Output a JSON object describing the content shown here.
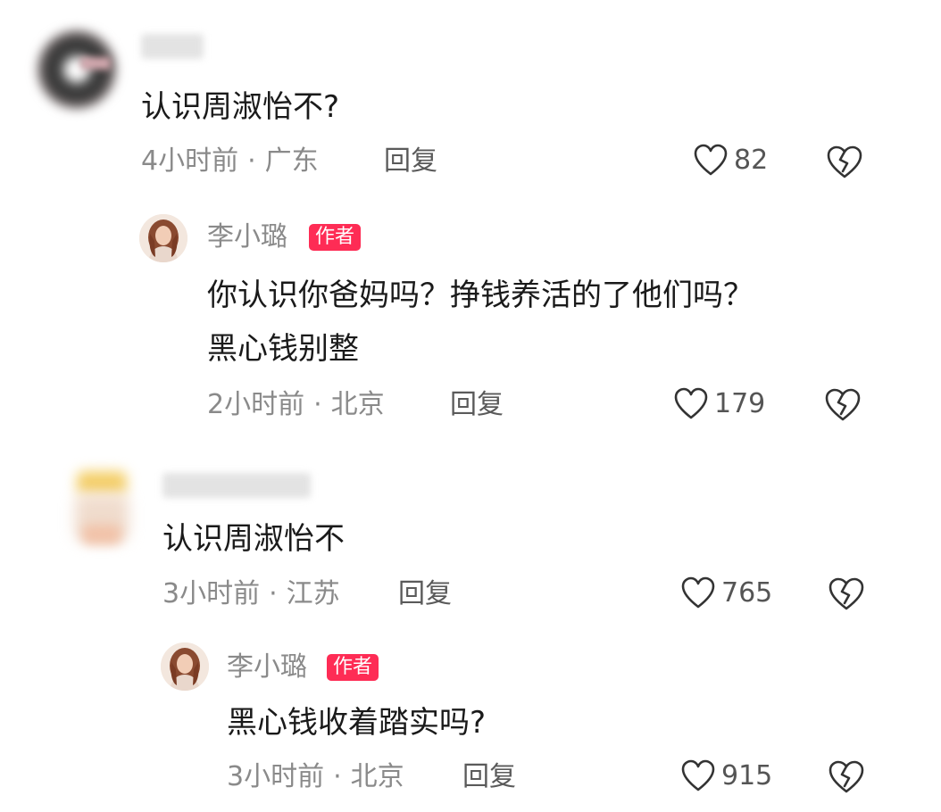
{
  "comments": [
    {
      "text": "认识周淑怡不?",
      "time": "4小时前",
      "location": "广东",
      "reply_label": "回复",
      "likes": "82",
      "reply": {
        "author": "李小璐",
        "badge": "作者",
        "text_line1": "你认识你爸妈吗？挣钱养活的了他们吗？",
        "text_line2": "黑心钱别整",
        "time": "2小时前",
        "location": "北京",
        "reply_label": "回复",
        "likes": "179"
      }
    },
    {
      "text": "认识周淑怡不",
      "time": "3小时前",
      "location": "江苏",
      "reply_label": "回复",
      "likes": "765",
      "reply": {
        "author": "李小璐",
        "badge": "作者",
        "text_line1": "黑心钱收着踏实吗?",
        "time": "3小时前",
        "location": "北京",
        "reply_label": "回复",
        "likes": "915"
      }
    }
  ],
  "separator": "·",
  "icons": {
    "like": "heart-outline-icon",
    "dislike": "broken-heart-icon"
  },
  "colors": {
    "badge": "#fe2c55",
    "meta": "#8a8a8a",
    "text": "#1a1a1a"
  }
}
